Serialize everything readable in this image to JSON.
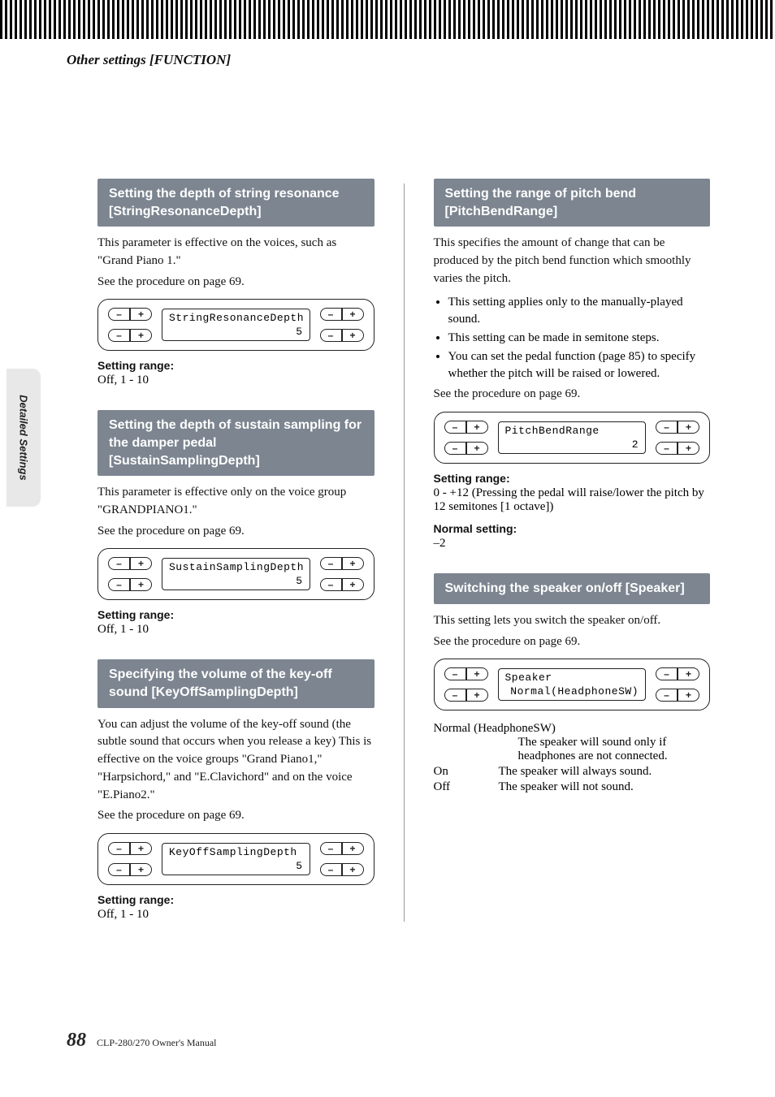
{
  "page": {
    "breadcrumb": "Other settings [FUNCTION]",
    "sidetab": "Detailed Settings",
    "page_number": "88",
    "manual": "CLP-280/270 Owner's Manual"
  },
  "buttons": {
    "minus": "–",
    "plus": "+"
  },
  "labels": {
    "setting_range": "Setting range:",
    "normal_setting": "Normal setting:"
  },
  "left": {
    "s1": {
      "title": "Setting the depth of string resonance [StringResonanceDepth]",
      "p1": "This parameter is effective on the voices, such as \"Grand Piano 1.\"",
      "p2": "See the procedure on page 69.",
      "lcd1": "StringResonanceDepth",
      "lcd2": "5",
      "range": "Off, 1 - 10"
    },
    "s2": {
      "title": "Setting the depth of sustain sampling for the damper pedal [SustainSamplingDepth]",
      "p1": "This parameter is effective only on the voice group \"GRANDPIANO1.\"",
      "p2": "See the procedure on page 69.",
      "lcd1": "SustainSamplingDepth",
      "lcd2": "5",
      "range": "Off, 1 - 10"
    },
    "s3": {
      "title": "Specifying the volume of the key-off sound [KeyOffSamplingDepth]",
      "p1": "You can adjust the volume of the key-off sound (the subtle sound that occurs when you release a key) This is effective on the voice groups \"Grand Piano1,\" \"Harpsichord,\" and \"E.Clavichord\" and on the voice \"E.Piano2.\"",
      "p2": "See the procedure on page 69.",
      "lcd1": "KeyOffSamplingDepth",
      "lcd2": "5",
      "range": "Off, 1 - 10"
    }
  },
  "right": {
    "s1": {
      "title": "Setting the range of pitch bend [PitchBendRange]",
      "p1": "This specifies the amount of change that can be produced by the pitch bend function which smoothly varies the pitch.",
      "b1": "This setting applies only to the manually-played sound.",
      "b2": "This setting can be made in semitone steps.",
      "b3": "You can set the pedal function (page 85) to specify whether the pitch will be raised or lowered.",
      "p2": "See the procedure on page 69.",
      "lcd1": "PitchBendRange",
      "lcd2": "2",
      "range": "0 - +12 (Pressing the pedal will raise/lower the pitch by 12 semitones [1 octave])",
      "normal": "–2"
    },
    "s2": {
      "title": "Switching the speaker on/off [Speaker]",
      "p1": "This setting lets you switch the speaker on/off.",
      "p2": "See the procedure on page 69.",
      "lcd1": "Speaker",
      "lcd2": "Normal(HeadphoneSW)",
      "row0k": "Normal (HeadphoneSW)",
      "row0v": "The speaker will sound only if headphones are not connected.",
      "row1k": "On",
      "row1v": "The speaker will always sound.",
      "row2k": "Off",
      "row2v": "The speaker will not sound."
    }
  }
}
